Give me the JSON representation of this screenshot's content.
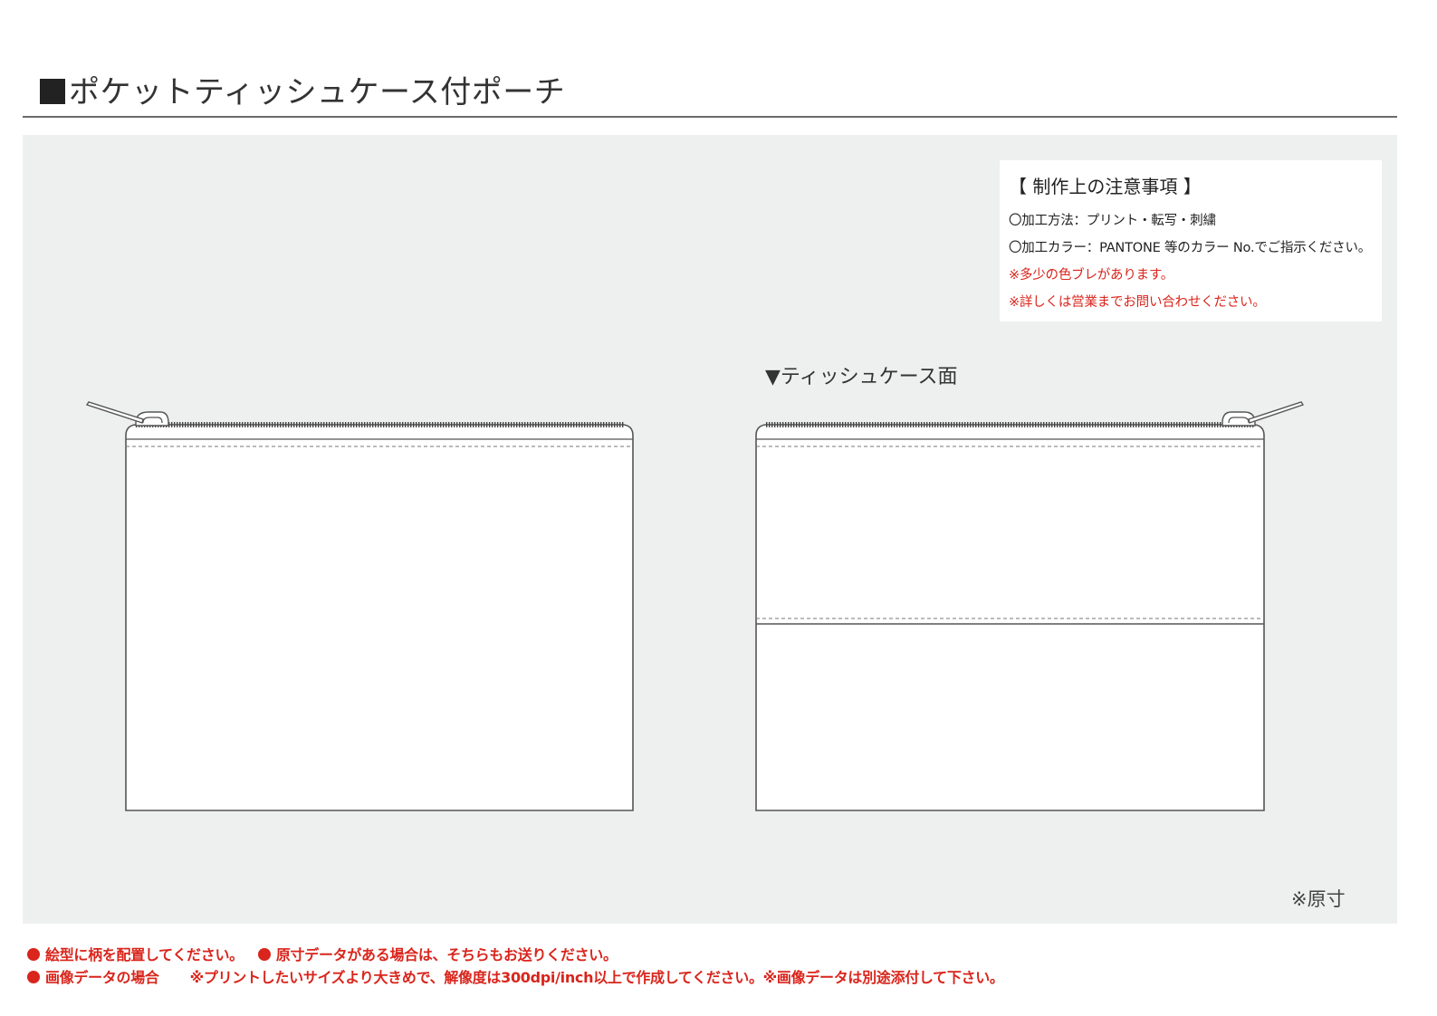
{
  "page": {
    "title": "ポケットティッシュケース付ポーチ"
  },
  "notes": {
    "heading": "【 制作上の注意事項 】",
    "lines": [
      "〇加工方法：プリント・転写・刺繍",
      "〇加工カラー：PANTONE 等のカラー No.でご指示ください。",
      "※多少の色ブレがあります。",
      "※詳しくは営業までお問い合わせください。"
    ]
  },
  "drawing": {
    "tissue_side_label": "▼ティッシュケース面",
    "scale_note": "※原寸"
  },
  "footer": {
    "line1_a": "絵型に柄を配置してください。",
    "line1_b": "原寸データがある場合は、そちらもお送りください。",
    "line2_a": "画像データの場合",
    "line2_b": "※プリントしたいサイズより大きめで、解像度は300dpi/inch以上で作成してください。※画像データは別途添付して下さい。"
  },
  "colors": {
    "panel_bg": "#eef0ef",
    "red": "#d9251c",
    "line": "#555555"
  }
}
